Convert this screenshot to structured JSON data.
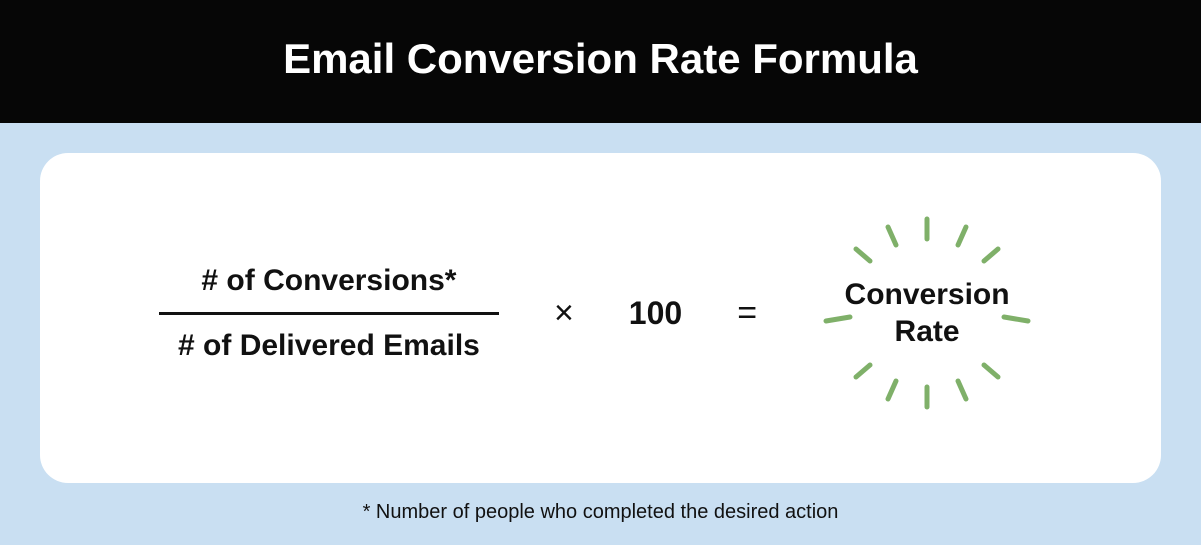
{
  "header": {
    "title": "Email Conversion Rate Formula"
  },
  "formula": {
    "numerator": "# of Conversions*",
    "denominator": "# of Delivered Emails",
    "multiply": "×",
    "constant": "100",
    "equals": "=",
    "result_line1": "Conversion",
    "result_line2": "Rate"
  },
  "footnote": "* Number of people who completed the desired action",
  "colors": {
    "burst": "#7fb069"
  }
}
